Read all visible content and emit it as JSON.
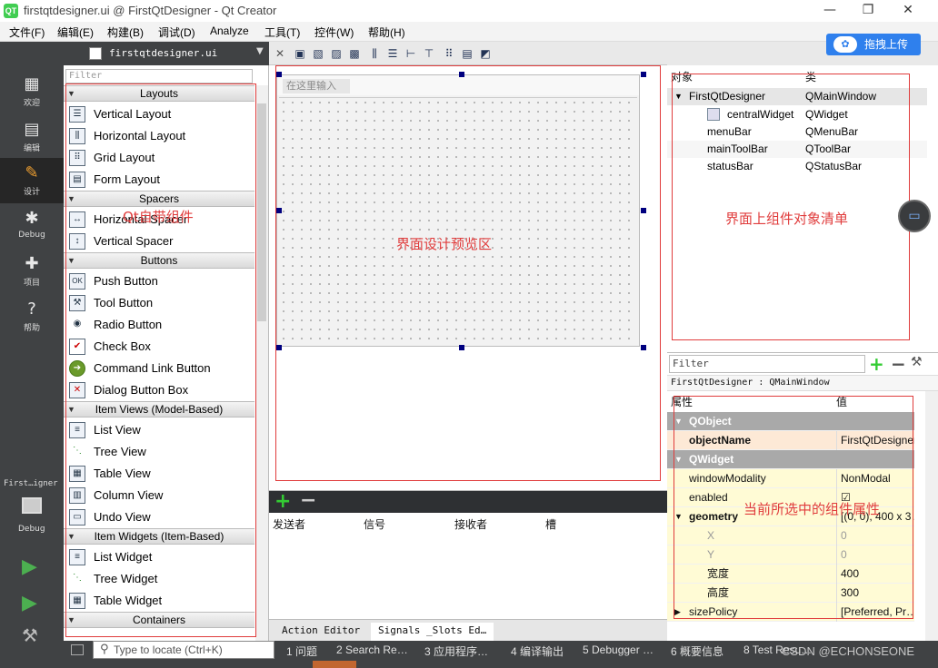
{
  "window": {
    "title": "firstqtdesigner.ui @ FirstQtDesigner - Qt Creator",
    "logo": "QT",
    "minimize": "—",
    "restore": "❐",
    "close": "✕"
  },
  "menu": [
    "文件(F)",
    "编辑(E)",
    "构建(B)",
    "调试(D)",
    "Analyze",
    "工具(T)",
    "控件(W)",
    "帮助(H)"
  ],
  "upload_button": "拖拽上传",
  "modes": [
    {
      "icon": "grid-icon",
      "label": "欢迎"
    },
    {
      "icon": "edit-icon",
      "label": "编辑"
    },
    {
      "icon": "design-icon",
      "label": "设计"
    },
    {
      "icon": "bug-icon",
      "label": "Debug"
    },
    {
      "icon": "wrench-icon",
      "label": "项目"
    },
    {
      "icon": "help-icon",
      "label": "帮助"
    }
  ],
  "kit": {
    "name": "First…igner",
    "label": "Debug"
  },
  "doc": {
    "filename": "firstqtdesigner.ui"
  },
  "widget_box": {
    "filter_placeholder": "Filter",
    "categories": [
      "Layouts",
      "Spacers",
      "Buttons",
      "Item Views (Model-Based)",
      "Item Widgets (Item-Based)",
      "Containers"
    ],
    "layouts": [
      "Vertical Layout",
      "Horizontal Layout",
      "Grid Layout",
      "Form Layout"
    ],
    "spacers": [
      "Horizontal Spacer",
      "Vertical Spacer"
    ],
    "buttons": [
      "Push Button",
      "Tool Button",
      "Radio Button",
      "Check Box",
      "Command Link Button",
      "Dialog Button Box"
    ],
    "item_views": [
      "List View",
      "Tree View",
      "Table View",
      "Column View",
      "Undo View"
    ],
    "item_widgets": [
      "List Widget",
      "Tree Widget",
      "Table Widget"
    ]
  },
  "form": {
    "menu_hint": "在这里输入"
  },
  "annotations": {
    "widgets": "Qt自带组件",
    "preview": "界面设计预览区",
    "objects": "界面上组件对象清单",
    "properties": "当前所选中的组件属性"
  },
  "signals": {
    "headers": [
      "发送者",
      "信号",
      "接收者",
      "槽"
    ],
    "tabs": [
      "Action Editor",
      "Signals _Slots Ed…"
    ]
  },
  "object_inspector": {
    "headers": [
      "对象",
      "类"
    ],
    "rows": [
      {
        "name": "FirstQtDesigner",
        "cls": "QMainWindow"
      },
      {
        "name": "centralWidget",
        "cls": "QWidget"
      },
      {
        "name": "menuBar",
        "cls": "QMenuBar"
      },
      {
        "name": "mainToolBar",
        "cls": "QToolBar"
      },
      {
        "name": "statusBar",
        "cls": "QStatusBar"
      }
    ]
  },
  "property_editor": {
    "filter": "Filter",
    "class_line": "FirstQtDesigner : QMainWindow",
    "headers": [
      "属性",
      "值"
    ],
    "rows": [
      {
        "k": "QObject",
        "v": "",
        "kind": "grp"
      },
      {
        "k": "objectName",
        "v": "FirstQtDesigner",
        "kind": "o"
      },
      {
        "k": "QWidget",
        "v": "",
        "kind": "grp"
      },
      {
        "k": "windowModality",
        "v": "NonModal",
        "kind": "y"
      },
      {
        "k": "enabled",
        "v": "☑",
        "kind": "y"
      },
      {
        "k": "geometry",
        "v": "[(0, 0), 400 x 3…",
        "kind": "y"
      },
      {
        "k": "X",
        "v": "0",
        "kind": "y"
      },
      {
        "k": "Y",
        "v": "0",
        "kind": "y"
      },
      {
        "k": "宽度",
        "v": "400",
        "kind": "y"
      },
      {
        "k": "高度",
        "v": "300",
        "kind": "y"
      },
      {
        "k": "sizePolicy",
        "v": "[Preferred, Pr…",
        "kind": "y"
      }
    ]
  },
  "statusbar": {
    "locate_placeholder": "Type to locate (Ctrl+K)",
    "items": [
      "1 问题",
      "2 Search Re…",
      "3 应用程序…",
      "4 编译输出",
      "5 Debugger …",
      "6 概要信息",
      "8 Test Resu…"
    ]
  },
  "watermark": "CSDN @ECHONSEONE"
}
